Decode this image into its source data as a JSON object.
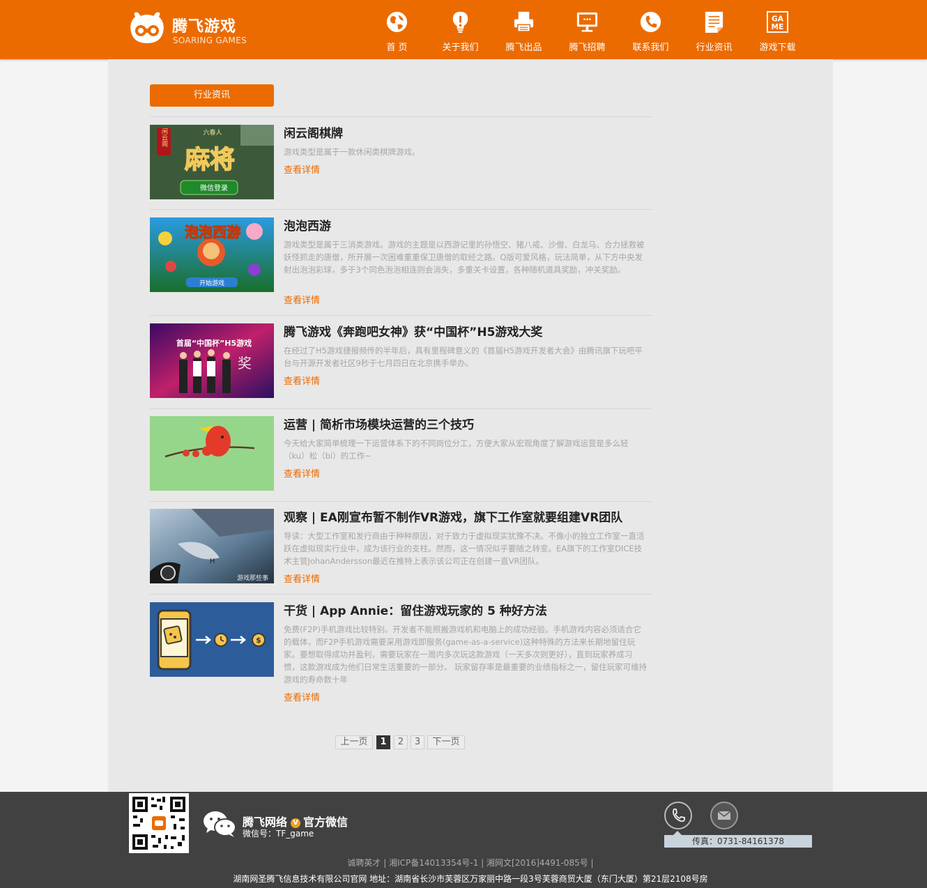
{
  "header": {
    "logo_cn": "腾飞游戏",
    "logo_en": "SOARING GAMES",
    "brand_color": "#ec6b00",
    "nav": [
      {
        "label": "首 页",
        "icon": "globe-icon"
      },
      {
        "label": "关于我们",
        "icon": "lightbulb-icon"
      },
      {
        "label": "腾飞出品",
        "icon": "printer-icon"
      },
      {
        "label": "腾飞招聘",
        "icon": "monitor-icon"
      },
      {
        "label": "联系我们",
        "icon": "phone-icon"
      },
      {
        "label": "行业资讯",
        "icon": "document-icon"
      },
      {
        "label": "游戏下载",
        "icon": "game-icon"
      }
    ]
  },
  "section": {
    "tag": "行业资讯"
  },
  "articles": [
    {
      "title": "闲云阁棋牌",
      "desc": "游戏类型是属于一款休闲类棋牌游戏。",
      "more": "查看详情"
    },
    {
      "title": "泡泡西游",
      "desc": "游戏类型是属于三消类游戏。游戏的主题是以西游记里的孙悟空、猪八戒、沙僧、白龙马、合力拯救被妖怪抓走的唐僧，所开展一次困难重重保卫唐僧的取经之路。Q版可爱风格，玩法简单，从下方中央发射出泡泡彩球，多于3个同色泡泡相连则会消失，多重关卡设置，各种随机道具奖励，冲关奖励。",
      "more": "查看详情"
    },
    {
      "title": "腾飞游戏《奔跑吧女神》获“中国杯”H5游戏大奖",
      "desc": "在经过了H5游戏捷报频传的半年后，具有里程碑意义的《首届H5游戏开发者大会》由腾讯旗下玩吧平台与开源开发者社区9秒于七月四日在北京携手举办。",
      "more": "查看详情"
    },
    {
      "title": "运营 | 简析市场模块运营的三个技巧",
      "desc": "今天给大家简单梳理一下运营体系下的不同岗位分工，方便大家从宏观角度了解游戏运营是多么轻（ku）松（bi）的工作~",
      "more": "查看详情"
    },
    {
      "title": "观察 | EA刚宣布暂不制作VR游戏，旗下工作室就要组建VR团队",
      "desc": "导读：大型工作室和发行商由于种种原因，对于致力于虚拟现实犹豫不决。不像小的独立工作室一直活跃在虚拟现实行业中，成为该行业的支柱。然而，这一情况似乎要随之转变。EA旗下的工作室DICE技术主管JohanAndersson最近在推特上表示该公司正在创建一直VR团队。",
      "more": "查看详情"
    },
    {
      "title": "干货 | App Annie：留住游戏玩家的 5 种好方法",
      "desc": "免费(F2P)手机游戏比较特别。开发者不能照搬游戏机和电脑上的成功经验。手机游戏内容必须适合它的载体，而F2P手机游戏需要采用游戏即服务(game-as-a-service)这种特殊的方法来长期地留住玩家。要想取得成功并盈利，需要玩家在一周内多次玩这款游戏（一天多次则更好），直到玩家养成习惯，这款游戏成为他们日常生活重要的一部分。 玩家留存率是最重要的业绩指标之一，留住玩家可维持游戏的寿命数十年",
      "more": "查看详情"
    }
  ],
  "thumbs": {
    "t1_logo": "闲云阁",
    "t1_main": "麻将",
    "t1_banner": "六春人",
    "t1_button": "微信登录",
    "t2_banner": "泡泡西游",
    "t2_bottom": "开始游戏",
    "t3_banner": "首届“中国杯”H5游戏",
    "t3_side": "奖",
    "t5_letter": "H",
    "t5_watermark": "游戏那些事"
  },
  "pagination": {
    "prev": "上一页",
    "pages": [
      "1",
      "2",
      "3"
    ],
    "current": "1",
    "next": "下一页"
  },
  "footer": {
    "wx_name": "腾飞网络",
    "wx_badge": "V",
    "wx_official": "官方微信",
    "wx_id": "微信号：TF_game",
    "fax": "传真：0731-84161378",
    "links": [
      "诚聘英才",
      "湘ICP备14013354号-1",
      "湘网文[2016]4491-085号"
    ],
    "sep": "|",
    "address": "湖南网圣腾飞信息技术有限公司官网 地址：湖南省长沙市芙蓉区万家丽中路一段3号芙蓉商贸大厦（东门大厦）第21层2108号房"
  }
}
